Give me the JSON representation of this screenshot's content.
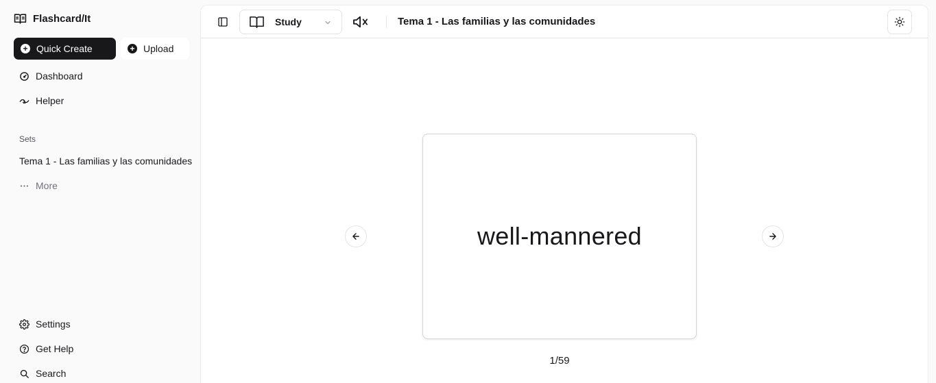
{
  "brand": {
    "name": "Flashcard/It",
    "icon": "book-open-icon"
  },
  "sidebar": {
    "quick_create": "Quick Create",
    "upload": "Upload",
    "nav": [
      {
        "label": "Dashboard",
        "icon": "gauge-icon"
      },
      {
        "label": "Helper",
        "icon": "handshake-icon"
      }
    ],
    "sets_label": "Sets",
    "sets": [
      {
        "label": "Tema 1 - Las familias y las comunidades"
      }
    ],
    "more_label": "More",
    "footer": [
      {
        "label": "Settings",
        "icon": "gear-icon"
      },
      {
        "label": "Get Help",
        "icon": "help-circle-icon"
      },
      {
        "label": "Search",
        "icon": "search-icon"
      }
    ]
  },
  "toolbar": {
    "mode": {
      "label": "Study",
      "icon": "book-open-icon",
      "selected": "Study"
    },
    "audio": "muted",
    "set_title": "Tema 1 - Las familias y las comunidades",
    "theme_icon": "sun-icon"
  },
  "card": {
    "term": "well-mannered",
    "counter": "1/59",
    "position": 1,
    "total": 59
  },
  "colors": {
    "primary": "#18181b",
    "background": "#fafafa",
    "surface": "#ffffff",
    "border": "#e4e4e7",
    "muted_text": "#71717a"
  }
}
